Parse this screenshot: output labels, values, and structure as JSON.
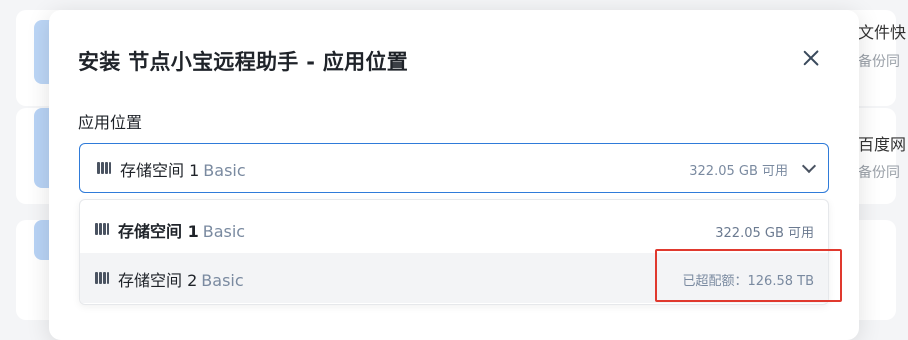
{
  "background": {
    "cards": [
      {
        "title": "文件快",
        "subtitle": "备份同"
      },
      {
        "title": "百度网",
        "subtitle": "备份同"
      }
    ]
  },
  "dialog": {
    "title": "安装 节点小宝远程助手 - 应用位置",
    "close_icon": "close-icon",
    "field_label": "应用位置",
    "selected": {
      "name": "存储空间 1",
      "tag": "Basic",
      "capacity": "322.05 GB 可用"
    },
    "options": [
      {
        "name": "存储空间 1",
        "tag": "Basic",
        "status": "322.05 GB 可用",
        "bold": true
      },
      {
        "name": "存储空间 2",
        "tag": "Basic",
        "status": "已超配额：126.58 TB",
        "bold": false
      }
    ]
  },
  "colors": {
    "accent": "#2f7bd9",
    "annotation": "#e0392e",
    "muted_text": "#7a8aa0"
  }
}
